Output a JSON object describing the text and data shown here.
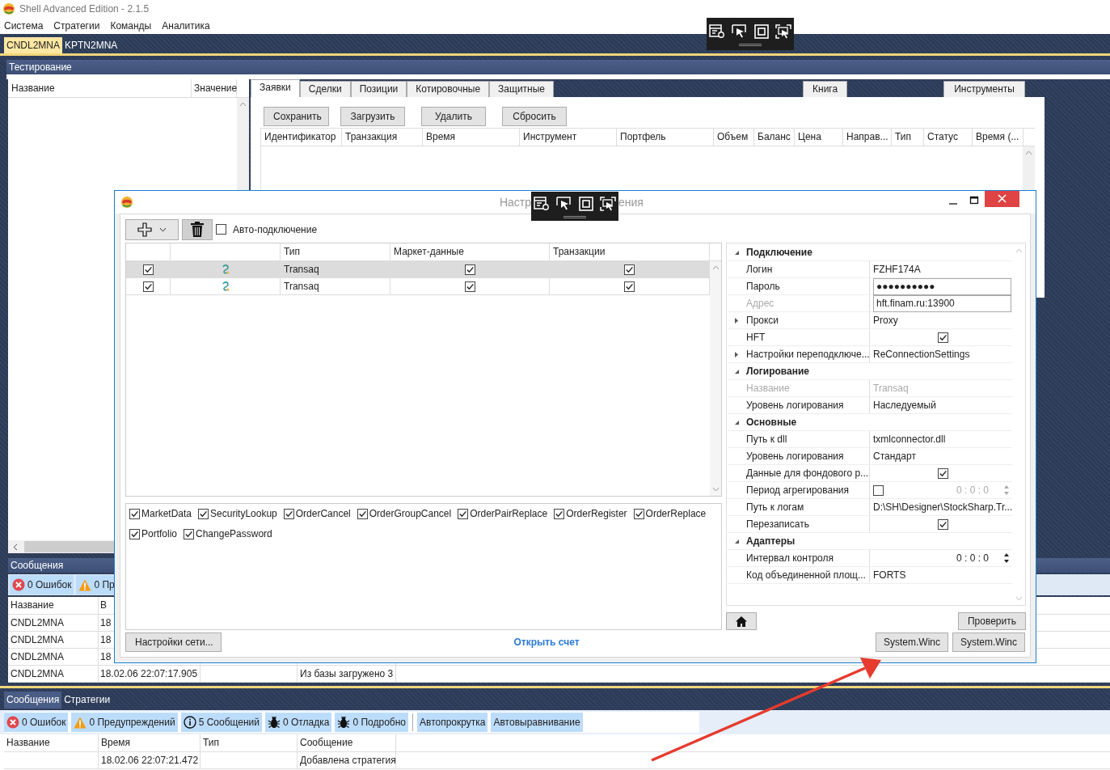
{
  "window": {
    "title": "Shell Advanced Edition - 2.1.5"
  },
  "menu": [
    "Система",
    "Стратегии",
    "Команды",
    "Аналитика"
  ],
  "doc_tabs": [
    {
      "label": "CNDL2MNA",
      "selected": true
    },
    {
      "label": "KPTN2MNA",
      "selected": false
    }
  ],
  "testing_panel": {
    "title": "Тестирование",
    "params_table": {
      "columns": [
        "Название",
        "Значение"
      ]
    },
    "tabs": [
      {
        "label": "Заявки",
        "selected": true
      },
      {
        "label": "Сделки",
        "selected": false
      },
      {
        "label": "Позиции",
        "selected": false
      },
      {
        "label": "Котировочные",
        "selected": false
      },
      {
        "label": "Защитные",
        "selected": false
      }
    ],
    "side_tabs": [
      {
        "label": "Книга",
        "selected": false
      },
      {
        "label": "Инструменты",
        "selected": false
      }
    ],
    "buttons": [
      "Сохранить",
      "Загрузить",
      "Удалить",
      "Сбросить"
    ],
    "orders_table": {
      "columns": [
        "Идентификатор",
        "Транзакция",
        "Время",
        "Инструмент",
        "Портфель",
        "Объем",
        "Баланс",
        "Цена",
        "Направ...",
        "Тип",
        "Статус",
        "Время (..."
      ]
    }
  },
  "messages_panel": {
    "title": "Сообщения",
    "filters": [
      {
        "kind": "error",
        "label": "0 Ошибок"
      },
      {
        "kind": "warning",
        "label": "0 Пр"
      }
    ],
    "table": {
      "columns": [
        "Название",
        "В"
      ],
      "rows": [
        {
          "name": "CNDL2MNA",
          "time": "18"
        },
        {
          "name": "CNDL2MNA",
          "time": "18"
        },
        {
          "name": "CNDL2MNA",
          "time": "18"
        },
        {
          "name": "CNDL2MNA",
          "time": "18.02.06 22:07:17.905",
          "message": "Из базы загружено 3"
        }
      ]
    }
  },
  "bottom_dock": {
    "tabs": [
      {
        "label": "Сообщения",
        "selected": true
      },
      {
        "label": "Стратегии",
        "selected": false
      }
    ],
    "filters": [
      {
        "kind": "error",
        "label": "0 Ошибок"
      },
      {
        "kind": "warning",
        "label": "0 Предупреждений"
      },
      {
        "kind": "info",
        "label": "5 Сообщений"
      },
      {
        "kind": "bug",
        "label": "0 Отладка"
      },
      {
        "kind": "bug",
        "label": "0 Подробно"
      }
    ],
    "toggles": [
      "Автопрокрутка",
      "Автовыравнивание"
    ],
    "table": {
      "columns": [
        "Название",
        "Время",
        "Тип",
        "Сообщение"
      ],
      "rows": [
        {
          "time": "18.02.06 22:07:21.472",
          "message": "Добавлена стратегия"
        }
      ]
    }
  },
  "dialog": {
    "title_start": "Настр",
    "title_end": "ения",
    "auto_connect": {
      "label": "Авто-подключение",
      "checked": false
    },
    "connections": {
      "columns": [
        {},
        {},
        {
          "label": "Тип"
        },
        {
          "label": "Маркет-данные"
        },
        {
          "label": "Транзакции"
        }
      ],
      "rows": [
        {
          "enabled": true,
          "type": "Transaq",
          "market_data": true,
          "transactions": true,
          "selected": true
        },
        {
          "enabled": true,
          "type": "Transaq",
          "market_data": true,
          "transactions": true,
          "selected": false
        }
      ]
    },
    "message_types": [
      {
        "label": "MarketData",
        "checked": true
      },
      {
        "label": "SecurityLookup",
        "checked": true
      },
      {
        "label": "OrderCancel",
        "checked": true
      },
      {
        "label": "OrderGroupCancel",
        "checked": true
      },
      {
        "label": "OrderPairReplace",
        "checked": true
      },
      {
        "label": "OrderRegister",
        "checked": true
      },
      {
        "label": "OrderReplace",
        "checked": true
      },
      {
        "label": "Portfolio",
        "checked": true
      },
      {
        "label": "ChangePassword",
        "checked": true
      }
    ],
    "properties": [
      {
        "category": "Подключение",
        "expanded": true,
        "rows": [
          {
            "kind": "text",
            "label": "Логин",
            "value": "FZHF174A"
          },
          {
            "kind": "field",
            "label": "Пароль",
            "value": "●●●●●●●●●●"
          },
          {
            "kind": "field",
            "label": "Адрес",
            "value": "hft.finam.ru:13900",
            "disabled": true
          },
          {
            "kind": "subgroup",
            "label": "Прокси",
            "value": "Proxy",
            "expanded": false
          },
          {
            "kind": "checkbox",
            "label": "HFT",
            "checked": true
          },
          {
            "kind": "subgroup",
            "label": "Настройки переподключе...",
            "value": "ReConnectionSettings",
            "expanded": false
          }
        ]
      },
      {
        "category": "Логирование",
        "expanded": true,
        "rows": [
          {
            "kind": "text",
            "label": "Название",
            "value": "Transaq",
            "disabled": true
          },
          {
            "kind": "text",
            "label": "Уровень логирования",
            "value": "Наследуемый"
          }
        ]
      },
      {
        "category": "Основные",
        "expanded": true,
        "rows": [
          {
            "kind": "text",
            "label": "Путь к dll",
            "value": "txmlconnector.dll"
          },
          {
            "kind": "text",
            "label": "Уровень логирования",
            "value": "Стандарт"
          },
          {
            "kind": "checkbox",
            "label": "Данные для фондового р...",
            "checked": true
          },
          {
            "kind": "timespan",
            "label": "Период агрегирования",
            "value": "0 : 0 : 0",
            "checked": false
          },
          {
            "kind": "text",
            "label": "Путь к логам",
            "value": "D:\\SH\\Designer\\StockSharp.Tr..."
          },
          {
            "kind": "checkbox",
            "label": "Перезаписать",
            "checked": true
          }
        ]
      },
      {
        "category": "Адаптеры",
        "expanded": true,
        "rows": [
          {
            "kind": "timespan",
            "label": "Интервал контроля",
            "value": "0 : 0 : 0"
          },
          {
            "kind": "text",
            "label": "Код объединенной площ...",
            "value": "FORTS"
          }
        ]
      }
    ],
    "network_button": "Настройки сети...",
    "open_account_link": "Открыть счет",
    "check_button": "Проверить",
    "footer_buttons": [
      "System.Winc",
      "System.Winc"
    ]
  }
}
